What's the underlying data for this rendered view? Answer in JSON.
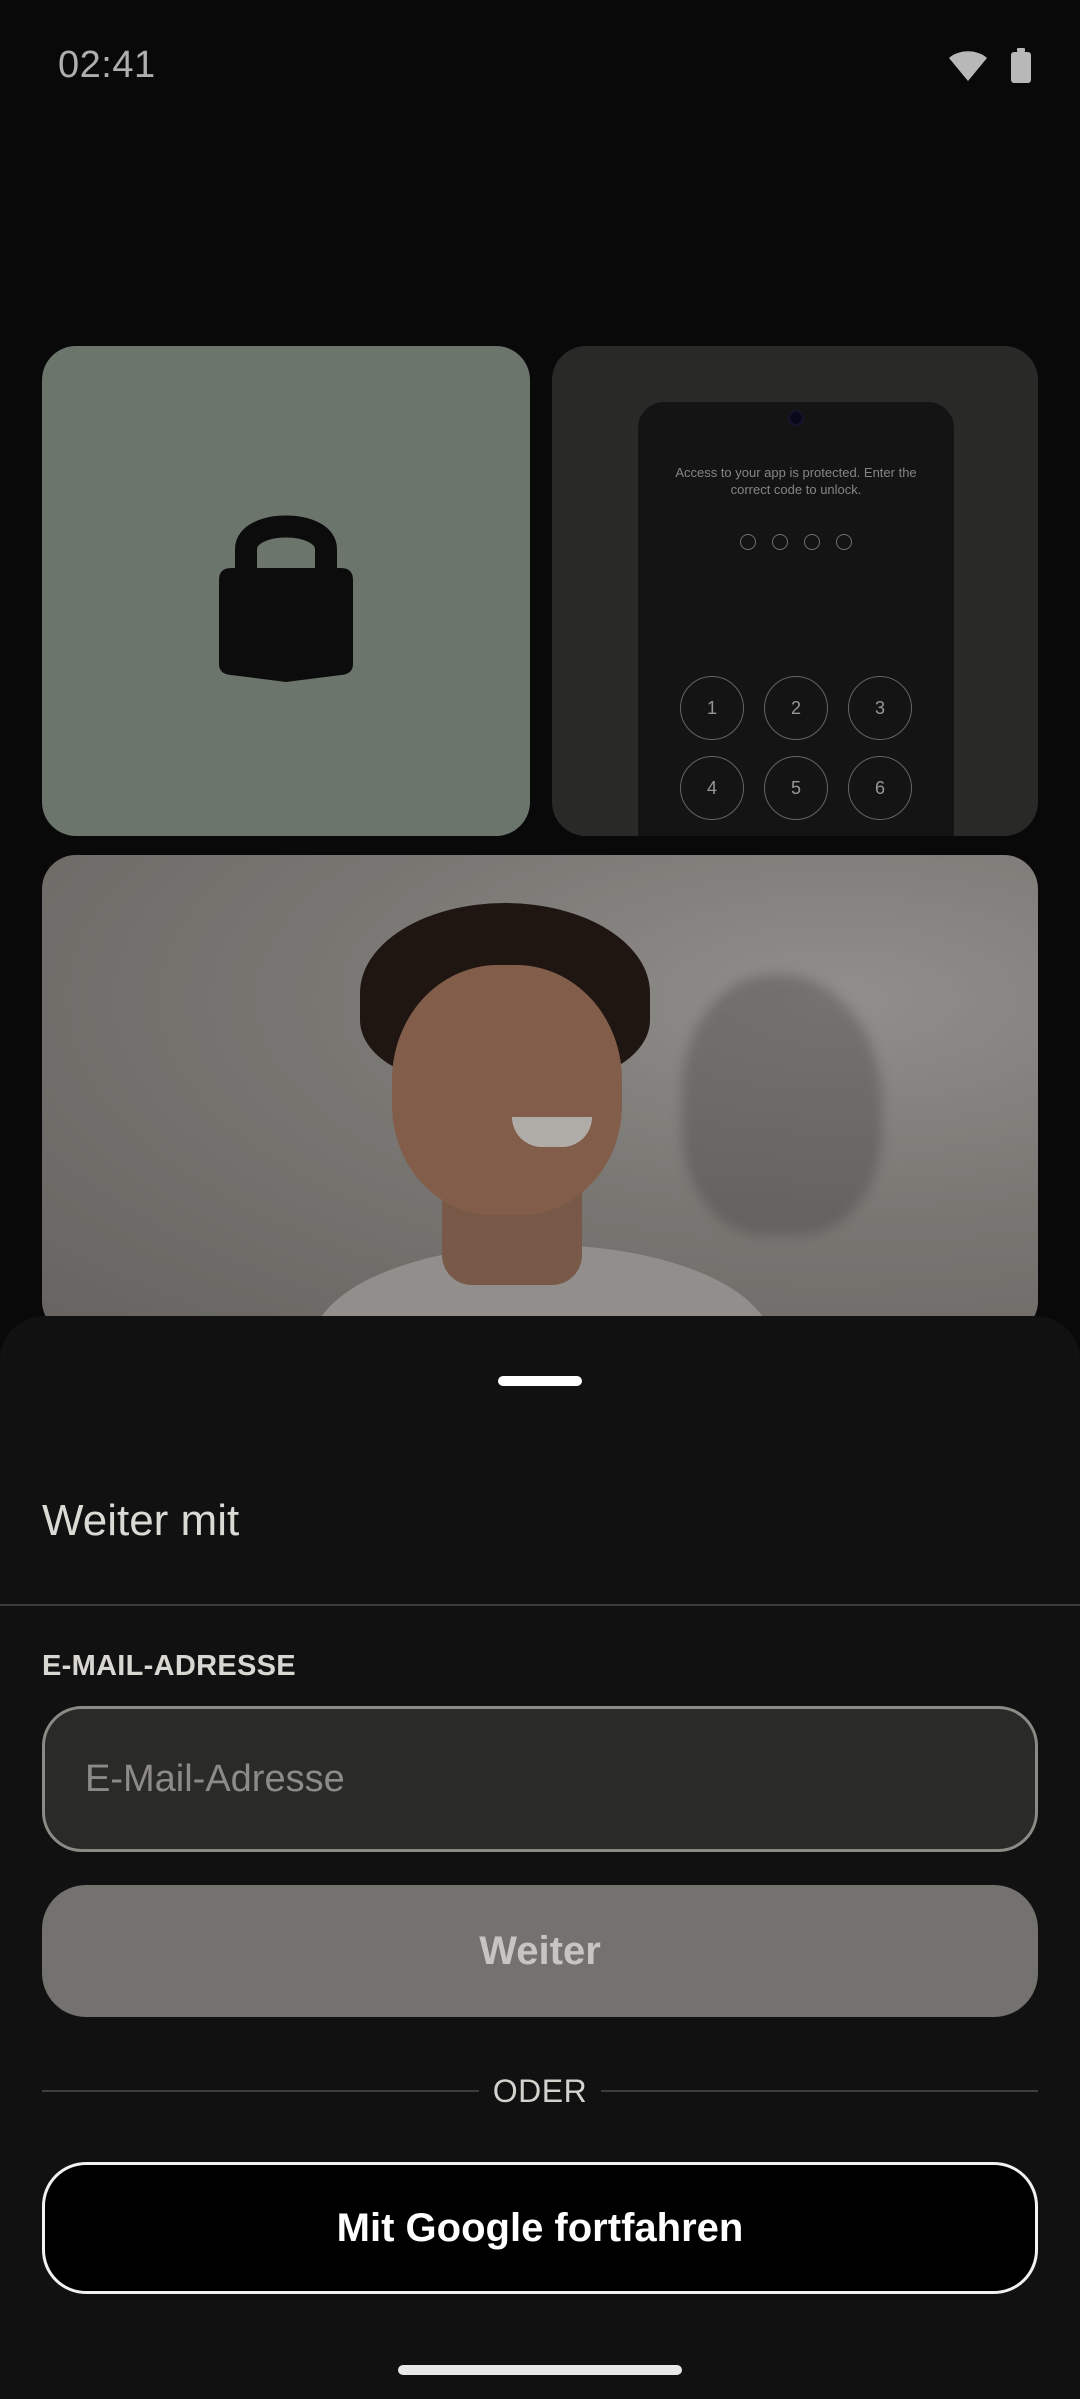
{
  "status_bar": {
    "time": "02:41",
    "icons": [
      "wifi-icon",
      "battery-icon"
    ]
  },
  "background": {
    "lock_card": {
      "icon": "lock-icon",
      "color": "#95a295"
    },
    "pin_card": {
      "message": "Access to your app is protected. Enter the correct code to unlock.",
      "pin_length": 4,
      "keys": [
        "1",
        "2",
        "3",
        "4",
        "5",
        "6"
      ]
    },
    "photo_card": {
      "description_icon": "person-photo"
    }
  },
  "sheet": {
    "title": "Weiter mit",
    "email_label": "E-MAIL-ADRESSE",
    "email_placeholder": "E-Mail-Adresse",
    "email_value": "",
    "continue_label": "Weiter",
    "or_label": "ODER",
    "google_label": "Mit Google fortfahren"
  },
  "colors": {
    "sheet_bg": "#111111",
    "continue_disabled": "#73726e",
    "accent_sage": "#95a295"
  }
}
